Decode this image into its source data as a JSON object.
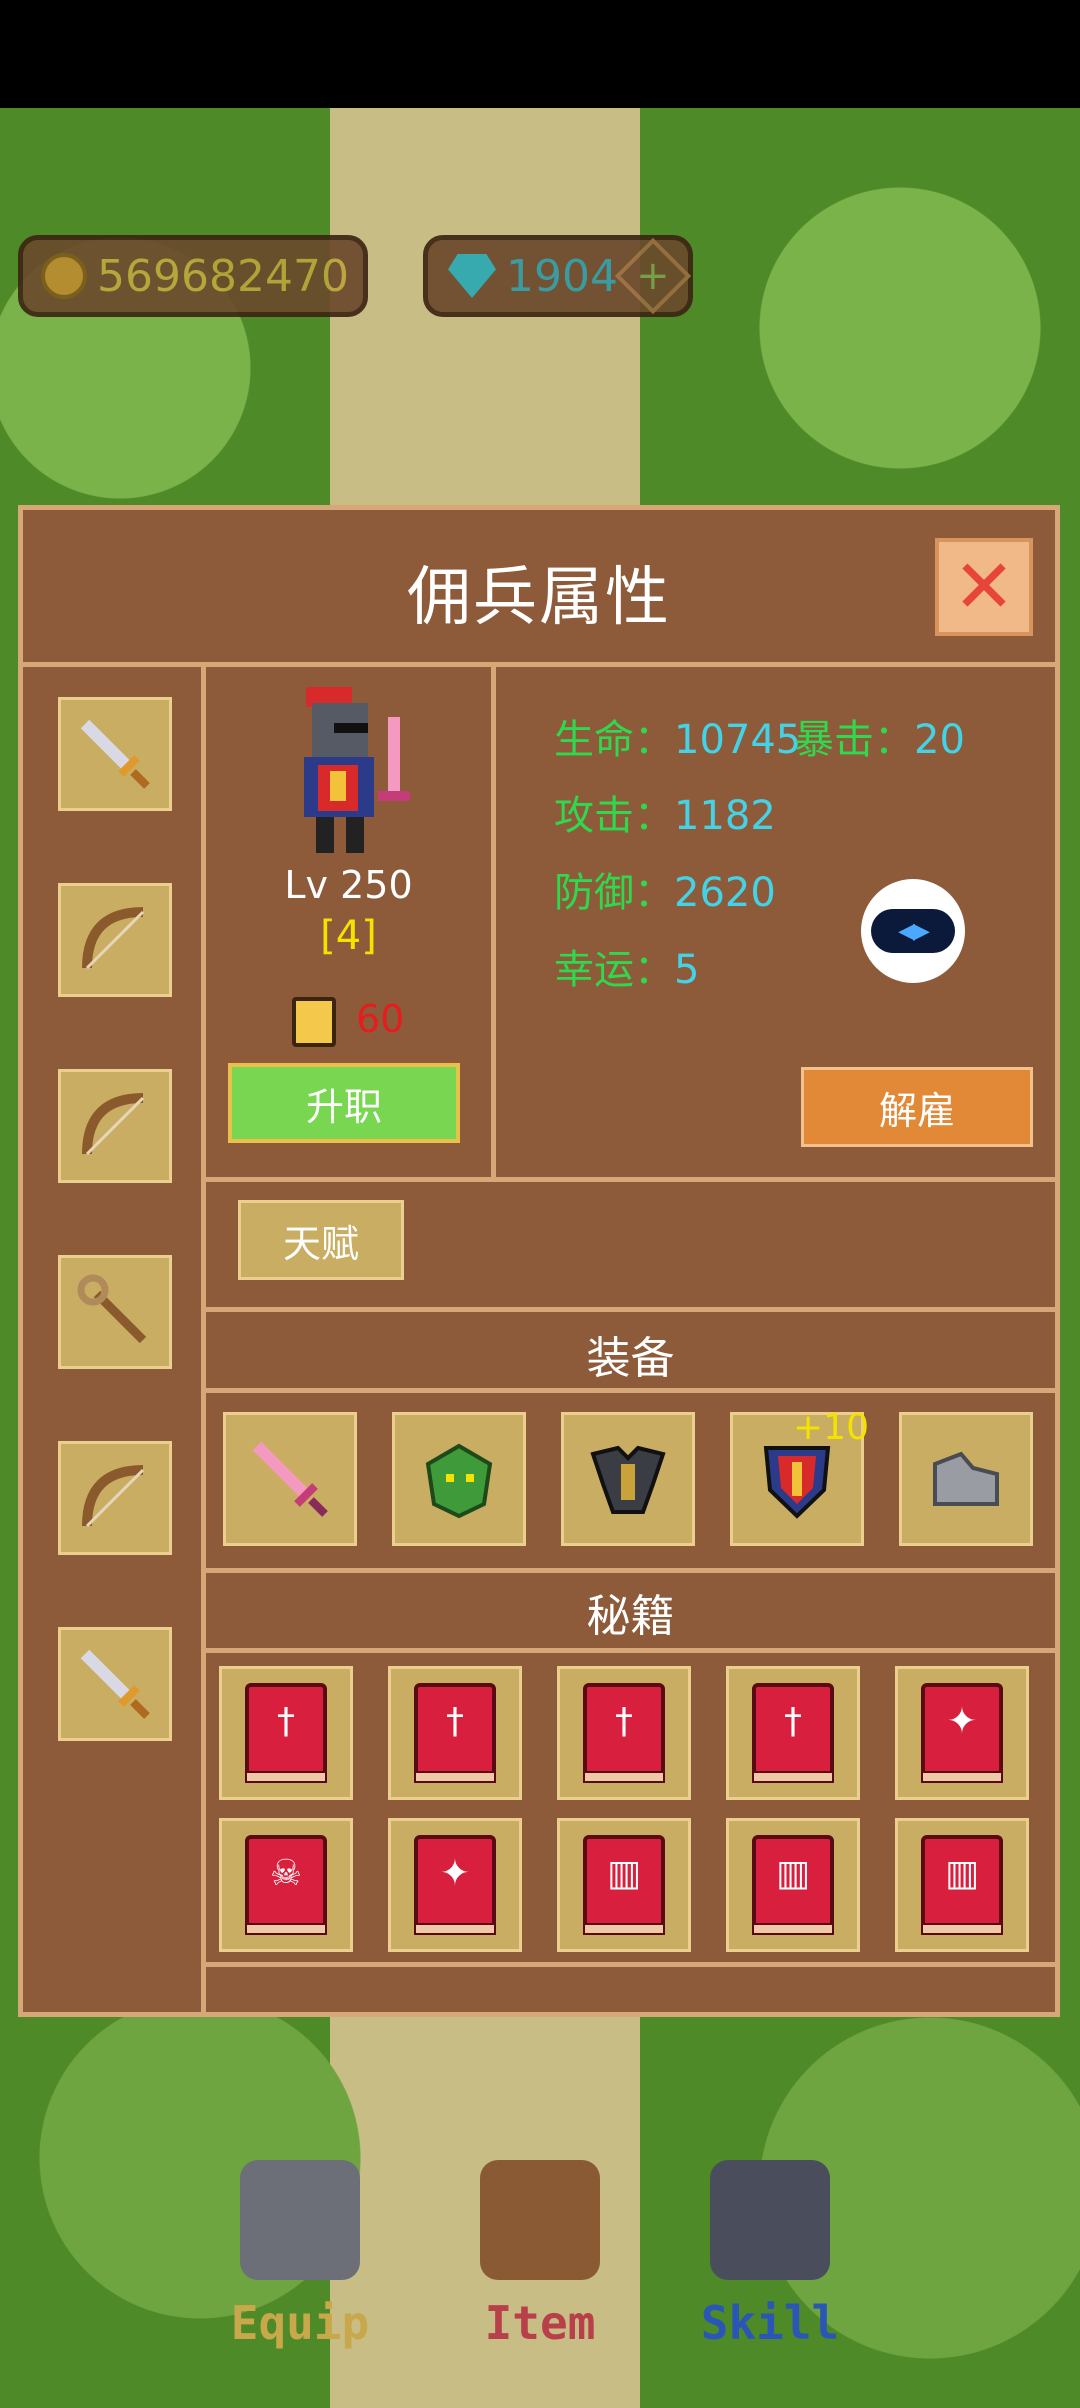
{
  "resources": {
    "gold": "569682470",
    "gems": "1904",
    "plus_symbol": "+"
  },
  "panel": {
    "title": "佣兵属性",
    "close_symbol": "✕",
    "weapon_slots": [
      "sword-icon",
      "bow-icon",
      "bow-icon",
      "staff-icon",
      "bow-icon",
      "sword-icon"
    ],
    "character": {
      "level": "Lv 250",
      "rank": "[4]",
      "promote_cost": "60",
      "promote_label": "升职"
    },
    "stats": {
      "hp_label": "生命：",
      "hp_value": "10745",
      "crit_label": "暴击：",
      "crit_value": "20",
      "atk_label": "攻击：",
      "atk_value": "1182",
      "def_label": "防御：",
      "def_value": "2620",
      "luck_label": "幸运：",
      "luck_value": "5"
    },
    "dismiss_label": "解雇",
    "talent_label": "天赋",
    "equipment_title": "装备",
    "equipment": [
      {
        "icon": "pink-sword-icon",
        "enhance": ""
      },
      {
        "icon": "dragon-helmet-icon",
        "enhance": ""
      },
      {
        "icon": "dark-armor-icon",
        "enhance": ""
      },
      {
        "icon": "shield-icon",
        "enhance": "+10"
      },
      {
        "icon": "stone-boots-icon",
        "enhance": ""
      }
    ],
    "skills_title": "秘籍",
    "skill_books": [
      [
        "sword-book-icon",
        "sword-book-icon",
        "sword-book-icon",
        "sword-book-icon",
        "star-book-icon"
      ],
      [
        "skull-book-icon",
        "star-book-icon",
        "armor-book-icon",
        "armor-book-icon",
        "armor-book-icon"
      ]
    ]
  },
  "nav": {
    "equip": "Equip",
    "item": "Item",
    "skill": "Skill"
  },
  "colors": {
    "panel_bg": "#8d5b3a",
    "border": "#d6a877",
    "stat_label": "#2fd84c",
    "stat_value": "#44d2e6",
    "promote": "#79d651",
    "dismiss": "#e28937"
  }
}
